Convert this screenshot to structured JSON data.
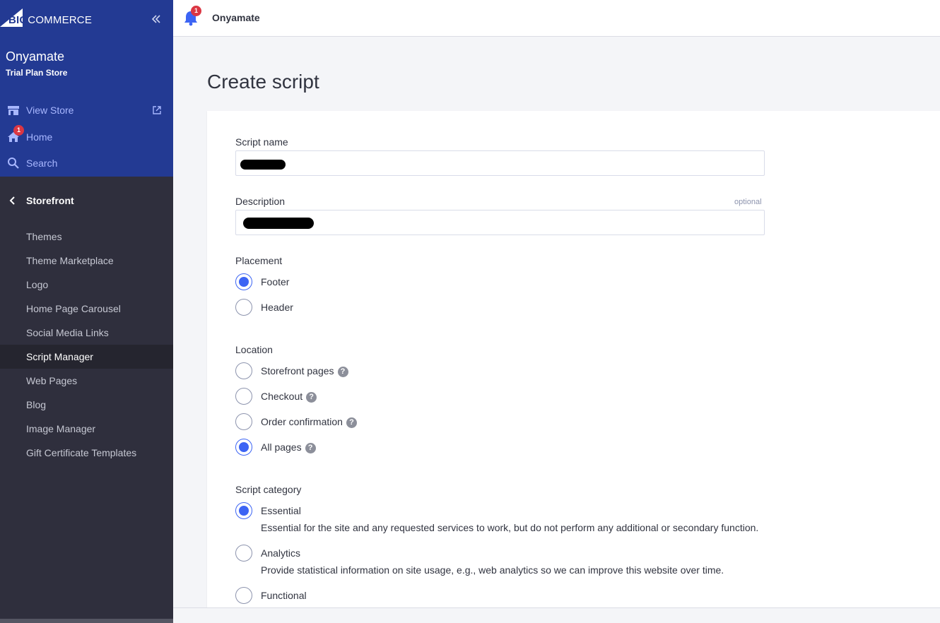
{
  "brand": {
    "logo_big": "BIG",
    "logo_commerce": "COMMERCE"
  },
  "sidebar": {
    "store_name": "Onyamate",
    "store_plan": "Trial Plan Store",
    "top_items": [
      {
        "label": "View Store",
        "icon": "storefront-icon"
      },
      {
        "label": "Home",
        "icon": "home-icon",
        "badge": "1"
      },
      {
        "label": "Search",
        "icon": "search-icon"
      }
    ],
    "section": "Storefront",
    "items": [
      {
        "label": "Themes"
      },
      {
        "label": "Theme Marketplace"
      },
      {
        "label": "Logo"
      },
      {
        "label": "Home Page Carousel"
      },
      {
        "label": "Social Media Links"
      },
      {
        "label": "Script Manager",
        "active": true
      },
      {
        "label": "Web Pages"
      },
      {
        "label": "Blog"
      },
      {
        "label": "Image Manager"
      },
      {
        "label": "Gift Certificate Templates"
      }
    ]
  },
  "topbar": {
    "notification_count": "1",
    "store_name": "Onyamate"
  },
  "page": {
    "title": "Create script"
  },
  "form": {
    "script_name_label": "Script name",
    "description_label": "Description",
    "description_optional": "optional",
    "placement_label": "Placement",
    "placement_options": [
      "Footer",
      "Header"
    ],
    "placement_selected": "Footer",
    "location_label": "Location",
    "location_options": [
      "Storefront pages",
      "Checkout",
      "Order confirmation",
      "All pages"
    ],
    "location_selected": "All pages",
    "category_label": "Script category",
    "category_options": [
      {
        "label": "Essential",
        "description": "Essential for the site and any requested services to work, but do not perform any additional or secondary function."
      },
      {
        "label": "Analytics",
        "description": "Provide statistical information on site usage, e.g., web analytics so we can improve this website over time."
      },
      {
        "label": "Functional",
        "description": ""
      }
    ],
    "category_selected": "Essential"
  },
  "colors": {
    "sidebar_top": "#233a93",
    "sidebar_dark": "#2f2f3d",
    "accent": "#3c64f4",
    "badge": "#db3643"
  }
}
